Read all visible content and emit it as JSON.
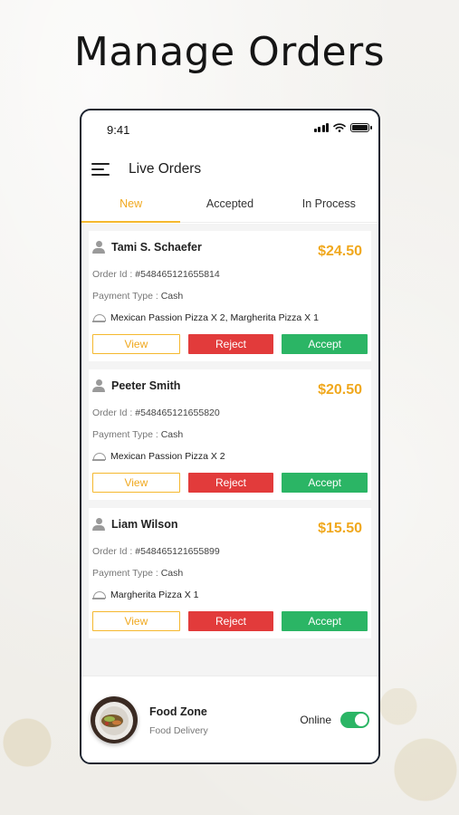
{
  "headline": "Manage Orders",
  "status_bar": {
    "time": "9:41"
  },
  "header": {
    "title": "Live Orders"
  },
  "tabs": [
    {
      "label": "New",
      "active": true
    },
    {
      "label": "Accepted",
      "active": false
    },
    {
      "label": "In Process",
      "active": false
    }
  ],
  "labels": {
    "order_id": "Order Id :",
    "payment_type": "Payment Type :",
    "view": "View",
    "reject": "Reject",
    "accept": "Accept"
  },
  "orders": [
    {
      "customer": "Tami S. Schaefer",
      "price": "$24.50",
      "order_id": "#548465121655814",
      "payment": "Cash",
      "items": "Mexican Passion Pizza X 2, Margherita Pizza X 1"
    },
    {
      "customer": "Peeter Smith",
      "price": "$20.50",
      "order_id": "#548465121655820",
      "payment": "Cash",
      "items": "Mexican Passion Pizza X 2"
    },
    {
      "customer": "Liam Wilson",
      "price": "$15.50",
      "order_id": "#548465121655899",
      "payment": "Cash",
      "items": "Margherita Pizza X 1"
    }
  ],
  "store": {
    "name": "Food Zone",
    "type": "Food Delivery",
    "status_label": "Online",
    "online": true
  },
  "colors": {
    "accent": "#f0a81e",
    "reject": "#e23b3b",
    "accept": "#2bb565"
  },
  "icons": [
    "menu-icon",
    "signal-icon",
    "wifi-icon",
    "battery-icon",
    "user-icon",
    "dish-icon"
  ]
}
